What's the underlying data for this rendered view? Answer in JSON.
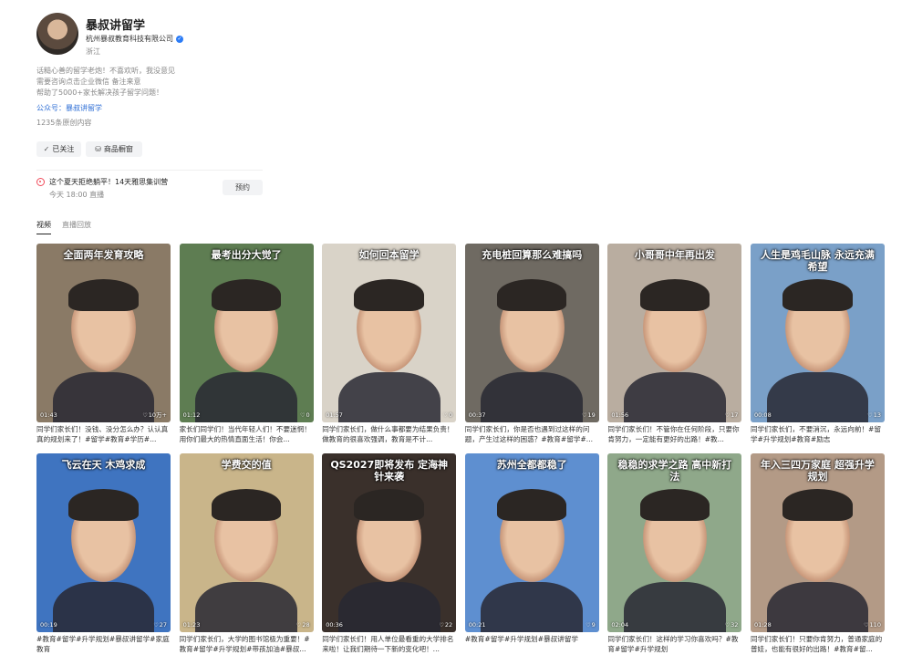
{
  "profile": {
    "name": "暴叔讲留学",
    "company": "杭州暴叔教育科技有限公司",
    "location": "浙江",
    "bio": [
      "话糙心善的留学老炮！不喜欢听，我没意见",
      "需要咨询点击企业微信 备注来意",
      "帮助了5000+家长解决孩子留学问题！"
    ],
    "gzh": "公众号：暴叔讲留学",
    "stat": "1235条原创内容",
    "follow_button": "已关注",
    "shop_button": "商品橱窗"
  },
  "live": {
    "title": "这个夏天拒绝躺平！14天雅思集训营",
    "time": "今天 18:00 直播",
    "reserve_button": "预约"
  },
  "tabs": [
    {
      "label": "视频",
      "active": true
    },
    {
      "label": "直播回放",
      "active": false
    }
  ],
  "videos": [
    {
      "caption": "全面两年发育攻略",
      "duration": "01:43",
      "likes": "10万+",
      "desc": "同学们家长们！没钱、没分怎么办？认认真真的规划来了！#留学#教育#学历#...",
      "bg": "#8a7a66"
    },
    {
      "caption": "最考出分大觉了",
      "duration": "01:12",
      "likes": "0",
      "desc": "家长们同学们！当代年轻人们！不要迷惘！用你们最大的热情直面生活！你会...",
      "bg": "#5e7d52"
    },
    {
      "caption": "如何回本留学",
      "duration": "01:57",
      "likes": "0",
      "desc": "同学们家长们，做什么事都要为结果负责！做教育的很喜欢强调，教育是不计...",
      "bg": "#d9d3c8"
    },
    {
      "caption": "充电桩回算那么难搞吗",
      "duration": "00:37",
      "likes": "19",
      "desc": "同学们家长们，你是否也遇到过这样的问题，产生过这样的困惑？#教育#留学#...",
      "bg": "#6f6a62"
    },
    {
      "caption": "小哥哥中年再出发",
      "duration": "01:56",
      "likes": "17",
      "desc": "同学们家长们！不管你在任何阶段，只要你肯努力，一定能有更好的出路！#教...",
      "bg": "#b9ada0"
    },
    {
      "caption": "人生是鸡毛山脉 永远充满希望",
      "duration": "00:08",
      "likes": "13",
      "desc": "同学们家长们，不要消沉，永远向前！#留学#升学规划#教育#励志",
      "bg": "#7aa0c8"
    },
    {
      "caption": "飞云在天 木鸡求成",
      "duration": "00:19",
      "likes": "27",
      "desc": "#教育#留学#升学规划#暴叔讲留学#家庭教育",
      "bg": "#3f74c0"
    },
    {
      "caption": "学费交的值",
      "duration": "01:23",
      "likes": "28",
      "desc": "同学们家长们，大学的图书馆极为重要！#教育#留学#升学规划#带孩加油#暴叔...",
      "bg": "#c9b58a"
    },
    {
      "caption": "QS2027即将发布 定海神针来袭",
      "duration": "00:36",
      "likes": "22",
      "desc": "同学们家长们！用人单位最看重的大学排名来啦！让我们期待一下新的变化吧！...",
      "bg": "#3a302b"
    },
    {
      "caption": "苏州全都都稳了",
      "duration": "00:21",
      "likes": "9",
      "desc": "#教育#留学#升学规划#暴叔讲留学",
      "bg": "#5e8fd0"
    },
    {
      "caption": "稳稳的求学之路 高中新打法",
      "duration": "02:04",
      "likes": "32",
      "desc": "同学们家长们！这样的学习你喜欢吗？#教育#留学#升学规划",
      "bg": "#8fa88a"
    },
    {
      "caption": "年入三四万家庭 超强升学规划",
      "duration": "01:28",
      "likes": "110",
      "desc": "同学们家长们！只要你肯努力，普通家庭的普娃，也能有很好的出路！#教育#留...",
      "bg": "#b39a86"
    }
  ],
  "colors": {
    "accent_blue": "#2f6fd6",
    "live_red": "#f04b5b",
    "verify_blue": "#2c7cf6"
  }
}
